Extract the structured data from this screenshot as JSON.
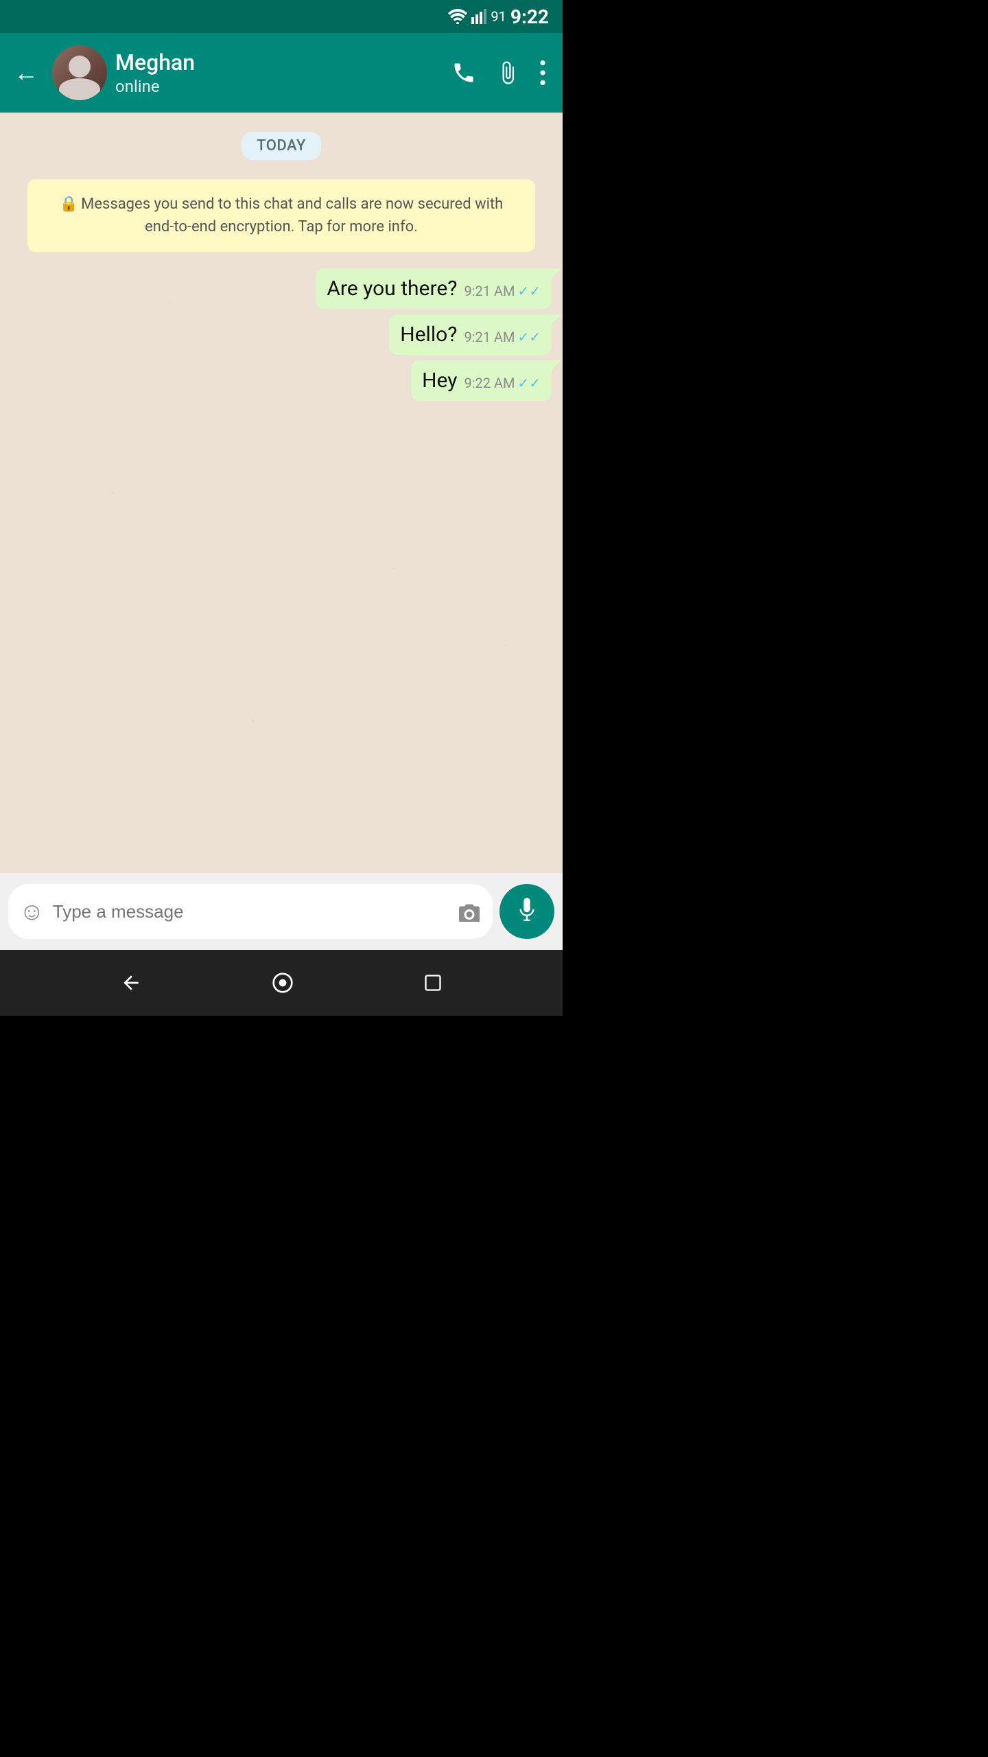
{
  "statusBar": {
    "time": "9:22",
    "batteryLevel": "91"
  },
  "toolbar": {
    "backLabel": "←",
    "contactName": "Meghan",
    "contactStatus": "online",
    "callLabel": "📞",
    "attachLabel": "📎",
    "moreLabel": "⋮"
  },
  "chat": {
    "datechip": "TODAY",
    "securityNotice": "Messages you send to this chat and calls are now secured with end-to-end encryption. Tap for more info.",
    "messages": [
      {
        "text": "Are you there?",
        "time": "9:21 AM",
        "receipt": "✓✓"
      },
      {
        "text": "Hello?",
        "time": "9:21 AM",
        "receipt": "✓✓"
      },
      {
        "text": "Hey",
        "time": "9:22 AM",
        "receipt": "✓✓"
      }
    ]
  },
  "input": {
    "placeholder": "Type a message",
    "emojiIcon": "☺",
    "cameraIcon": "📷"
  },
  "navbar": {
    "backIcon": "◀",
    "homeIcon": "○",
    "recentIcon": "□"
  }
}
